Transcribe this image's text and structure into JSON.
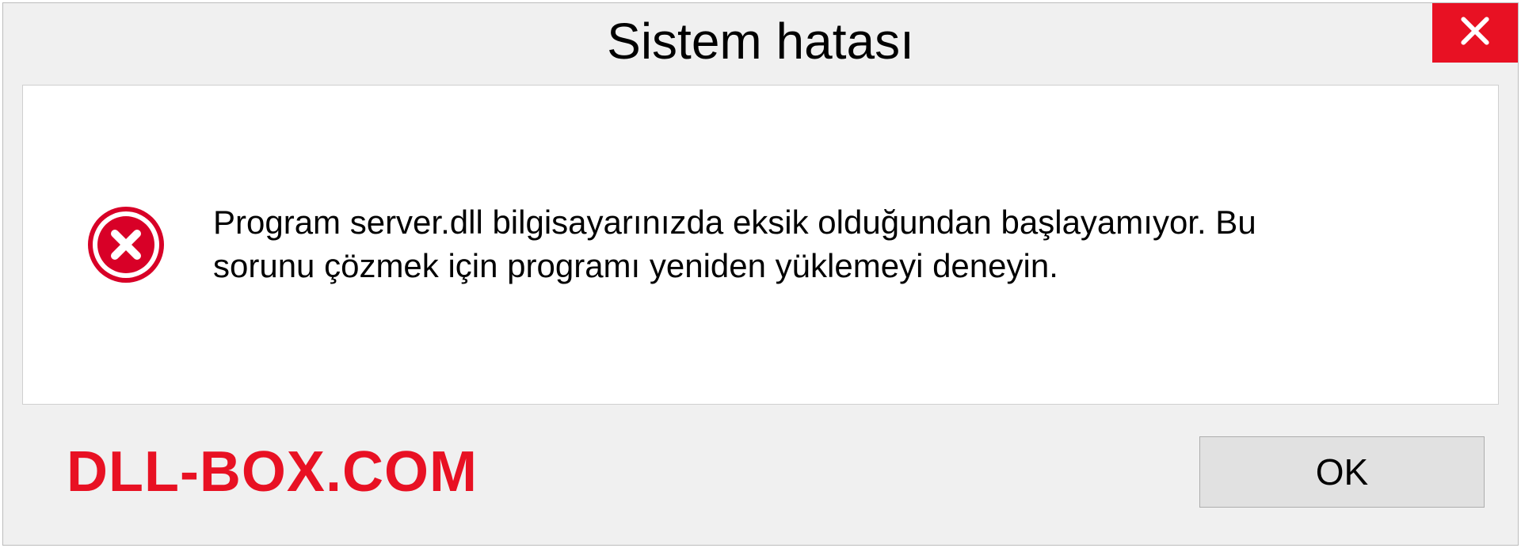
{
  "dialog": {
    "title": "Sistem hatası",
    "message": "Program server.dll bilgisayarınızda eksik olduğundan başlayamıyor. Bu sorunu çözmek için programı yeniden yüklemeyi deneyin.",
    "ok_label": "OK"
  },
  "watermark": "DLL-BOX.COM"
}
